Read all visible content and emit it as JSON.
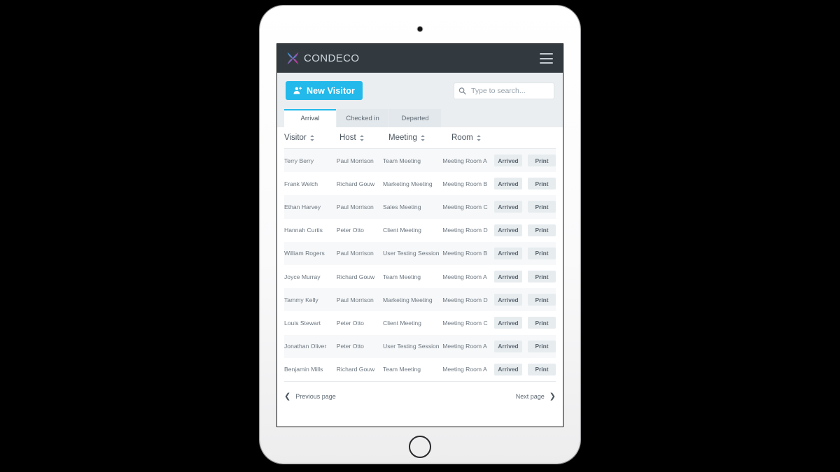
{
  "device": {
    "camera_name": "front-camera",
    "home_button_name": "home-button"
  },
  "header": {
    "brand_name": "CONDECO",
    "logo_icon": "condeco-x-logo",
    "menu_icon": "hamburger-menu-icon",
    "background": "#323a40",
    "brand_color_blue": "#29a3dc",
    "brand_color_magenta": "#e0218a"
  },
  "toolbar": {
    "new_visitor_label": "New Visitor",
    "new_visitor_icon": "user-plus-icon",
    "accent_color": "#23b9ea",
    "search": {
      "icon": "search-icon",
      "placeholder": "Type to search...",
      "value": ""
    }
  },
  "tabs": [
    {
      "label": "Arrival",
      "active": true
    },
    {
      "label": "Checked in",
      "active": false
    },
    {
      "label": "Departed",
      "active": false
    }
  ],
  "table": {
    "columns": [
      {
        "label": "Visitor",
        "sortable": true
      },
      {
        "label": "Host",
        "sortable": true
      },
      {
        "label": "Meeting",
        "sortable": true
      },
      {
        "label": "Room",
        "sortable": true
      }
    ],
    "action_labels": {
      "status": "Arrived",
      "print": "Print"
    },
    "rows": [
      {
        "visitor": "Terry Berry",
        "host": "Paul Morrison",
        "meeting": "Team Meeting",
        "room": "Meeting Room A",
        "status": "Arrived",
        "print": "Print"
      },
      {
        "visitor": "Frank Welch",
        "host": "Richard Gouw",
        "meeting": "Marketing Meeting",
        "room": "Meeting Room B",
        "status": "Arrived",
        "print": "Print"
      },
      {
        "visitor": "Ethan Harvey",
        "host": "Paul Morrison",
        "meeting": "Sales Meeting",
        "room": "Meeting Room C",
        "status": "Arrived",
        "print": "Print"
      },
      {
        "visitor": "Hannah Curtis",
        "host": "Peter Otto",
        "meeting": "Client Meeting",
        "room": "Meeting Room D",
        "status": "Arrived",
        "print": "Print"
      },
      {
        "visitor": "William Rogers",
        "host": "Paul Morrison",
        "meeting": "User Testing Session",
        "room": "Meeting Room B",
        "status": "Arrived",
        "print": "Print"
      },
      {
        "visitor": "Joyce Murray",
        "host": "Richard Gouw",
        "meeting": "Team Meeting",
        "room": "Meeting Room A",
        "status": "Arrived",
        "print": "Print"
      },
      {
        "visitor": "Tammy Kelly",
        "host": "Paul Morrison",
        "meeting": "Marketing Meeting",
        "room": "Meeting Room D",
        "status": "Arrived",
        "print": "Print"
      },
      {
        "visitor": "Louis Stewart",
        "host": "Peter Otto",
        "meeting": "Client Meeting",
        "room": "Meeting Room C",
        "status": "Arrived",
        "print": "Print"
      },
      {
        "visitor": "Jonathan Oliver",
        "host": "Peter Otto",
        "meeting": "User Testing Session",
        "room": "Meeting Room A",
        "status": "Arrived",
        "print": "Print"
      },
      {
        "visitor": "Benjamin Mills",
        "host": "Richard Gouw",
        "meeting": "Team Meeting",
        "room": "Meeting Room A",
        "status": "Arrived",
        "print": "Print"
      }
    ]
  },
  "pagination": {
    "previous_label": "Previous page",
    "next_label": "Next page",
    "previous_icon": "chevron-left-icon",
    "next_icon": "chevron-right-icon"
  }
}
